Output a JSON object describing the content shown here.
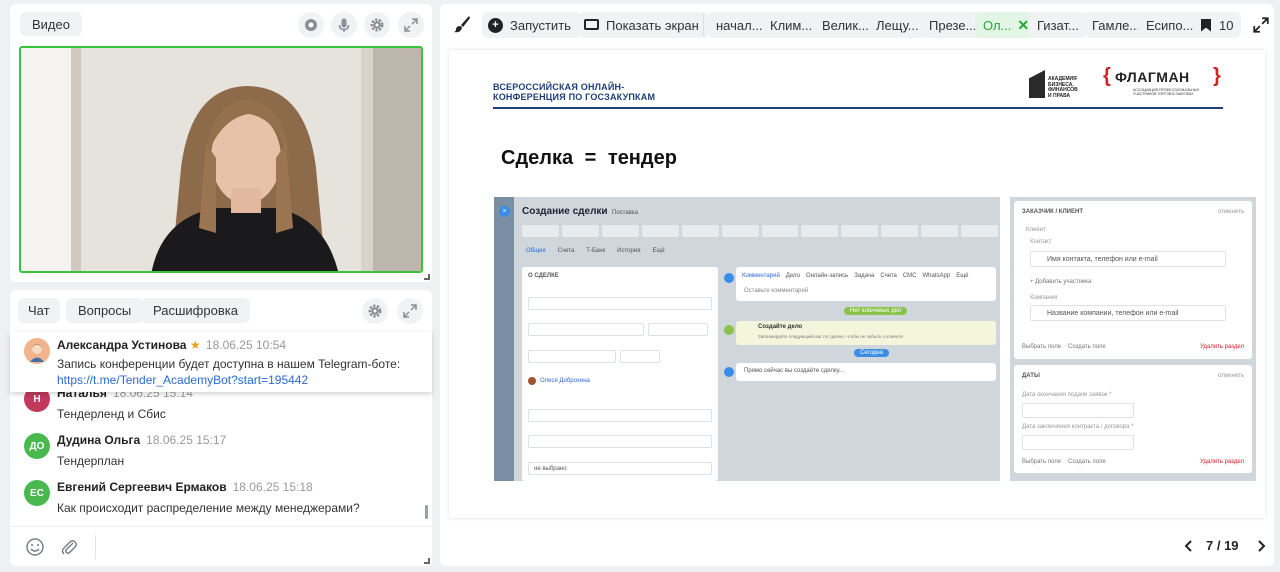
{
  "video": {
    "label": "Видео"
  },
  "chat": {
    "tabs": [
      "Чат",
      "Вопросы",
      "Расшифровка"
    ],
    "pinned": {
      "author": "Александра Устинова",
      "time": "18.06.25 10:54",
      "text": "Запись конференции будет доступна в нашем Telegram-боте:",
      "link": "https://t.me/Tender_AcademyBot?start=195442"
    },
    "messages": [
      {
        "initials": "Н",
        "author": "Наталья",
        "time": "18.06.25 15:14",
        "text": "Тендерленд и Сбис",
        "color": "#c1395d"
      },
      {
        "initials": "ДО",
        "author": "Дудина Ольга",
        "time": "18.06.25 15:17",
        "text": "Тендерплан",
        "color": "#48b84f"
      },
      {
        "initials": "ЕС",
        "author": "Евгений Сергеевич Ермаков",
        "time": "18.06.25 15:18",
        "text": "Как происходит распределение между менеджерами?",
        "color": "#48b84f"
      }
    ]
  },
  "toolbar": {
    "run_label": "Запустить",
    "share_label": "Показать экран",
    "tabs": [
      "начал...",
      "Клим...",
      "Велик...",
      "Лещу...",
      "Презе...",
      "Ол...",
      "Гизат...",
      "Гамле...",
      "Есипо..."
    ],
    "bookmarks_count": "10"
  },
  "slide": {
    "header_line1": "ВСЕРОССИЙСКАЯ ОНЛАЙН-",
    "header_line2": "КОНФЕРЕНЦИЯ ПО ГОСЗАКУПКАМ",
    "logo1_line1": "АКАДЕМИЯ",
    "logo1_line2": "БИЗНЕСА,",
    "logo1_line3": "ФИНАНСОВ",
    "logo1_line4": "И ПРАВА",
    "logo2": "ФЛАГМАН",
    "logo2_sub": "АССОЦИАЦИЯ ПРОФЕССИОНАЛЬНЫХ УЧАСТНИКОВ ТОРГОВ В ЗАКУПКАХ",
    "title": "Сделка = тендер",
    "left_shot": {
      "heading": "Создание сделки",
      "stage": "Поставка",
      "tabs": [
        "Общие",
        "Счета",
        "Т-Банк",
        "История",
        "Ещё"
      ],
      "section": "О СДЕЛКЕ",
      "timeline_tabs": [
        "Комментарий",
        "Дело",
        "Онлайн-запись",
        "Задача",
        "Счета",
        "СМС",
        "WhatsApp",
        "Ещё"
      ],
      "comment_placeholder": "Оставьте комментарий",
      "task_button": "Нет ключевых дел",
      "task_title": "Создайте дело",
      "task_sub": "Запланируйте следующий шаг по сделке, чтобы не забыть о клиенте",
      "today": "Сегодня",
      "note": "Прямо сейчас вы создаёте сделку...",
      "responsible": "Олеся Доброхина",
      "select_value": "не выбрано"
    },
    "right_shot": {
      "section1": "ЗАКАЗЧИК / КЛИЕНТ",
      "cancel": "отменить",
      "client": "Клиент",
      "contact": "Контакт",
      "contact_placeholder": "Имя контакта, телефон или e-mail",
      "add_participant": "+ Добавить участника",
      "company": "Компания",
      "company_placeholder": "Название компании, телефон или e-mail",
      "choose_field": "Выбрать поле",
      "create_field": "Создать поле",
      "delete_section": "Удалить раздел",
      "section2": "ДАТЫ",
      "date1": "Дата окончания подачи заявок *",
      "date2": "Дата заключения контракта / договора *"
    }
  },
  "pager": {
    "text": "7 / 19"
  },
  "colors": {
    "accent_green": "#39c43e",
    "brand_red": "#d32027",
    "slide_blue": "#1f3f7a"
  }
}
